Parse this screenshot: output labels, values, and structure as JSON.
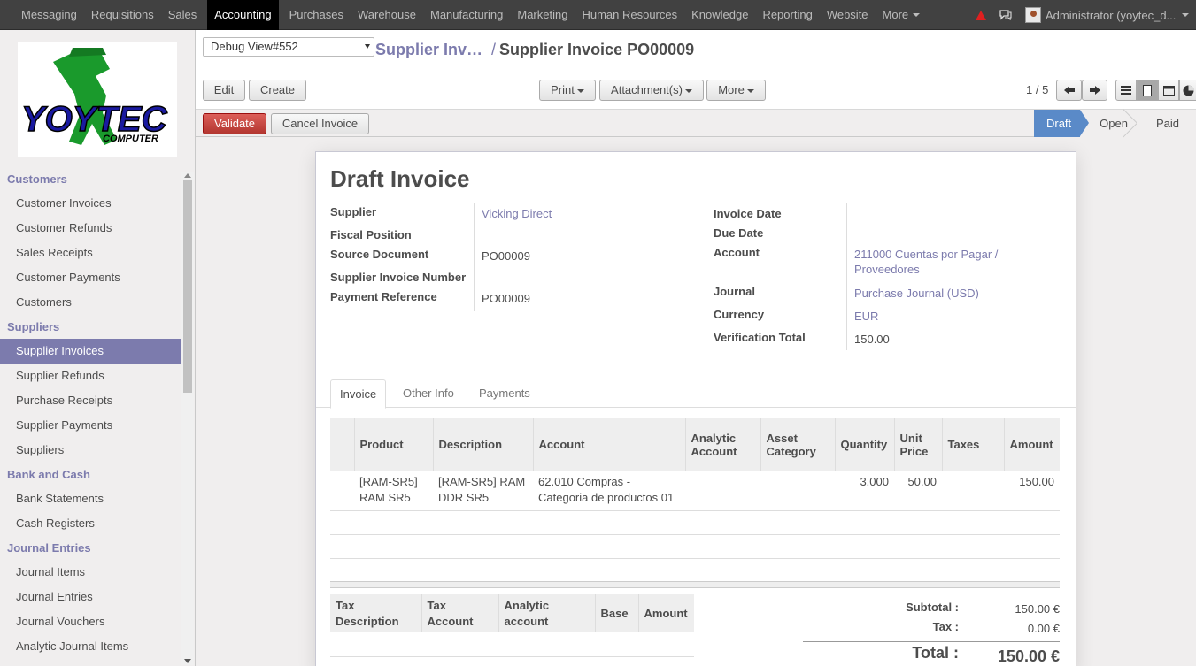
{
  "topnav": {
    "items": [
      "Messaging",
      "Requisitions",
      "Sales",
      "Accounting",
      "Purchases",
      "Warehouse",
      "Manufacturing",
      "Marketing",
      "Human Resources",
      "Knowledge",
      "Reporting",
      "Website",
      "More"
    ],
    "active": "Accounting",
    "user": "Administrator (yoytec_d..."
  },
  "sidebar": {
    "logo_text": "YOYTEC COMPUTER",
    "sections": [
      {
        "title": "Customers",
        "items": [
          "Customer Invoices",
          "Customer Refunds",
          "Sales Receipts",
          "Customer Payments",
          "Customers"
        ]
      },
      {
        "title": "Suppliers",
        "items": [
          "Supplier Invoices",
          "Supplier Refunds",
          "Purchase Receipts",
          "Supplier Payments",
          "Suppliers"
        ]
      },
      {
        "title": "Bank and Cash",
        "items": [
          "Bank Statements",
          "Cash Registers"
        ]
      },
      {
        "title": "Journal Entries",
        "items": [
          "Journal Items",
          "Journal Entries",
          "Journal Vouchers",
          "Analytic Journal Items"
        ]
      }
    ],
    "active_item": "Supplier Invoices"
  },
  "header": {
    "debug_select": "Debug View#552",
    "breadcrumb_parent": "Supplier Inv…",
    "breadcrumb_sep": "/",
    "breadcrumb_current": "Supplier Invoice PO00009",
    "edit_label": "Edit",
    "create_label": "Create",
    "print_label": "Print",
    "attachments_label": "Attachment(s)",
    "more_label": "More",
    "pager": "1 / 5"
  },
  "statusbar": {
    "validate_label": "Validate",
    "cancel_label": "Cancel Invoice",
    "steps": [
      "Draft",
      "Open",
      "Paid"
    ],
    "current_step": "Draft"
  },
  "form": {
    "title": "Draft Invoice",
    "left": {
      "supplier_label": "Supplier",
      "supplier": "Vicking Direct",
      "fiscal_label": "Fiscal Position",
      "fiscal": "",
      "source_label": "Source Document",
      "source": "PO00009",
      "sup_inv_label": "Supplier Invoice Number",
      "sup_inv": "",
      "payref_label": "Payment Reference",
      "payref": "PO00009"
    },
    "right": {
      "inv_date_label": "Invoice Date",
      "inv_date": "",
      "due_label": "Due Date",
      "due": "",
      "account_label": "Account",
      "account_l1": "211000 Cuentas por Pagar /",
      "account_l2": "Proveedores",
      "journal_label": "Journal",
      "journal": "Purchase Journal (USD)",
      "currency_label": "Currency",
      "currency": "EUR",
      "verif_label": "Verification Total",
      "verif": "150.00"
    },
    "tabs": [
      "Invoice",
      "Other Info",
      "Payments"
    ],
    "lines": {
      "headers": [
        "Product",
        "Description",
        "Account",
        "Analytic Account",
        "Asset Category",
        "Quantity",
        "Unit Price",
        "Taxes",
        "Amount"
      ],
      "rows": [
        {
          "product": "[RAM-SR5] RAM SR5",
          "description": "[RAM-SR5] RAM DDR SR5",
          "account": "62.010 Compras - Categoria de productos 01",
          "analytic": "",
          "asset": "",
          "qty": "3.000",
          "price": "50.00",
          "taxes": "",
          "amount": "150.00"
        }
      ]
    },
    "tax_table": {
      "headers": [
        "Tax Description",
        "Tax Account",
        "Analytic account",
        "Base",
        "Amount"
      ]
    },
    "totals": {
      "subtotal_label": "Subtotal :",
      "subtotal": "150.00 €",
      "tax_label": "Tax :",
      "tax": "0.00 €",
      "total_label": "Total :",
      "total": "150.00 €"
    }
  },
  "colors": {
    "accent": "#7c7bad",
    "topbar": "#414141",
    "validate": "#c9413b",
    "step_current": "#5a8ac8"
  }
}
